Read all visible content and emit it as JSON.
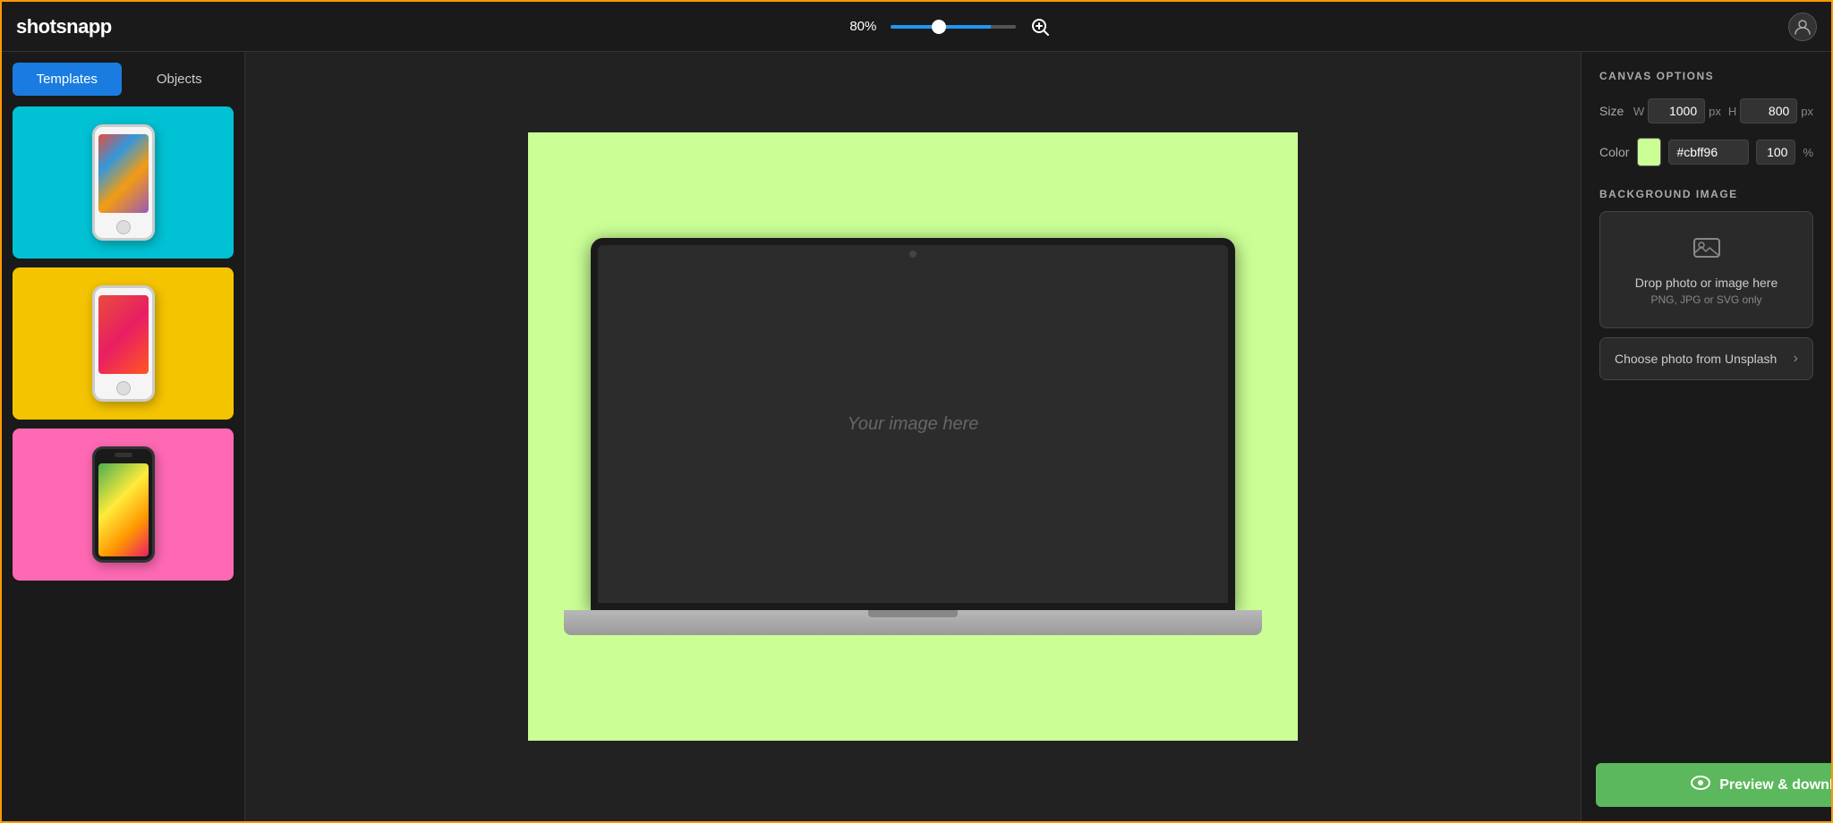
{
  "app": {
    "logo": "shotsnapp",
    "zoom_value": "80%",
    "zoom_level": 80
  },
  "sidebar_left": {
    "tab_templates": "Templates",
    "tab_objects": "Objects",
    "templates": [
      {
        "id": 1,
        "bg_color": "#00c2d4",
        "has_home_btn": true,
        "screen_art": "art-1"
      },
      {
        "id": 2,
        "bg_color": "#f5c400",
        "has_home_btn": true,
        "screen_art": "art-2"
      },
      {
        "id": 3,
        "bg_color": "#ff69b4",
        "has_home_btn": false,
        "screen_art": "art-3"
      }
    ]
  },
  "canvas": {
    "bg_color": "#cbff96",
    "image_placeholder": "Your image here"
  },
  "sidebar_right": {
    "canvas_options_label": "CANVAS OPTIONS",
    "size_label": "Size",
    "width_label": "W",
    "width_value": "1000",
    "width_unit": "px",
    "height_label": "H",
    "height_value": "800",
    "height_unit": "px",
    "color_label": "Color",
    "color_hex": "#cbff96",
    "color_opacity": "100",
    "color_opacity_unit": "%",
    "bg_image_label": "BACKGROUND IMAGE",
    "drop_main": "Drop photo or image here",
    "drop_sub": "PNG, JPG or SVG only",
    "unsplash_label": "Choose photo from Unsplash"
  },
  "footer": {
    "preview_download_label": "Preview & download"
  },
  "icons": {
    "user": "👤",
    "zoom_in": "⊕",
    "image_drop": "🖼",
    "eye": "👁",
    "chevron_right": "›"
  }
}
